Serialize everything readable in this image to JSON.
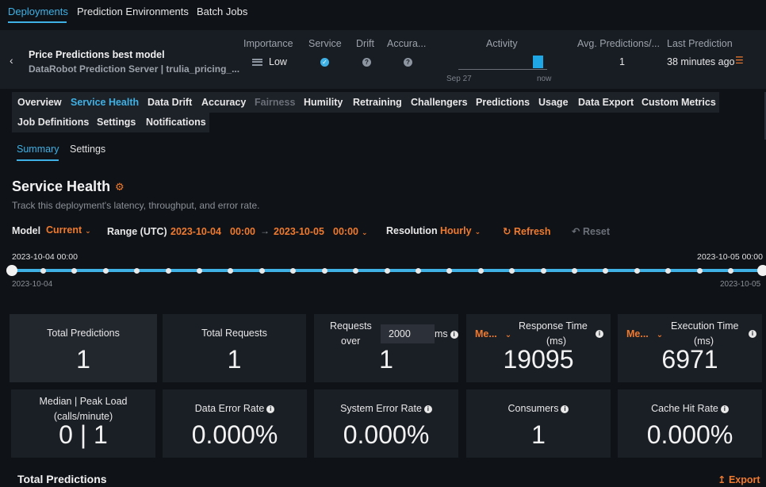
{
  "topnav": {
    "deployments": "Deployments",
    "environments": "Prediction Environments",
    "batch": "Batch Jobs"
  },
  "header": {
    "name": "Price Predictions best model",
    "server": "DataRobot Prediction Server | trulia_pricing_...",
    "labels": {
      "importance": "Importance",
      "service": "Service",
      "drift": "Drift",
      "accuracy": "Accura...",
      "activity": "Activity",
      "avg": "Avg. Predictions/...",
      "last": "Last Prediction"
    },
    "importance_value": "Low",
    "activity_start": "Sep 27",
    "activity_end": "now",
    "avg_value": "1",
    "last_value": "38 minutes ago"
  },
  "tabs": [
    "Overview",
    "Service Health",
    "Data Drift",
    "Accuracy",
    "Fairness",
    "Humility",
    "Retraining",
    "Challengers",
    "Predictions",
    "Usage",
    "Data Export",
    "Custom Metrics"
  ],
  "tabs2": [
    "Job Definitions",
    "Settings",
    "Notifications"
  ],
  "subtabs": {
    "summary": "Summary",
    "settings": "Settings"
  },
  "page": {
    "title": "Service Health",
    "desc": "Track this deployment's latency, throughput, and error rate."
  },
  "controls": {
    "model_label": "Model",
    "model_value": "Current",
    "range_label": "Range (UTC)",
    "start_date": "2023-10-04",
    "start_time": "00:00",
    "end_date": "2023-10-05",
    "end_time": "00:00",
    "resolution_label": "Resolution",
    "resolution_value": "Hourly",
    "refresh": "Refresh",
    "reset": "Reset"
  },
  "timeline": {
    "start_label": "2023-10-04 00:00",
    "end_label": "2023-10-05 00:00",
    "start_tick": "2023-10-04",
    "end_tick": "2023-10-05"
  },
  "cards": {
    "total_predictions": {
      "title": "Total Predictions",
      "value": "1"
    },
    "total_requests": {
      "title": "Total Requests",
      "value": "1"
    },
    "requests_over": {
      "line1": "Requests",
      "line2": "over",
      "input": "2000",
      "suffix": "ms",
      "value": "1"
    },
    "response_time": {
      "agg": "Me...",
      "title": "Response Time",
      "unit": "(ms)",
      "value": "19095"
    },
    "execution_time": {
      "agg": "Me...",
      "title": "Execution Time",
      "unit": "(ms)",
      "value": "6971"
    },
    "load": {
      "title": "Median | Peak Load",
      "unit": "(calls/minute)",
      "value": "0 | 1"
    },
    "data_error": {
      "title": "Data Error Rate",
      "value": "0.000%"
    },
    "system_error": {
      "title": "System Error Rate",
      "value": "0.000%"
    },
    "consumers": {
      "title": "Consumers",
      "value": "1"
    },
    "cache_hit": {
      "title": "Cache Hit Rate",
      "value": "0.000%"
    }
  },
  "section": {
    "title": "Total Predictions",
    "export": "Export"
  },
  "colors": {
    "accent": "#3fb1e5",
    "orange": "#ef7a2f",
    "bg": "#0f1217",
    "card": "#1a1e25"
  }
}
